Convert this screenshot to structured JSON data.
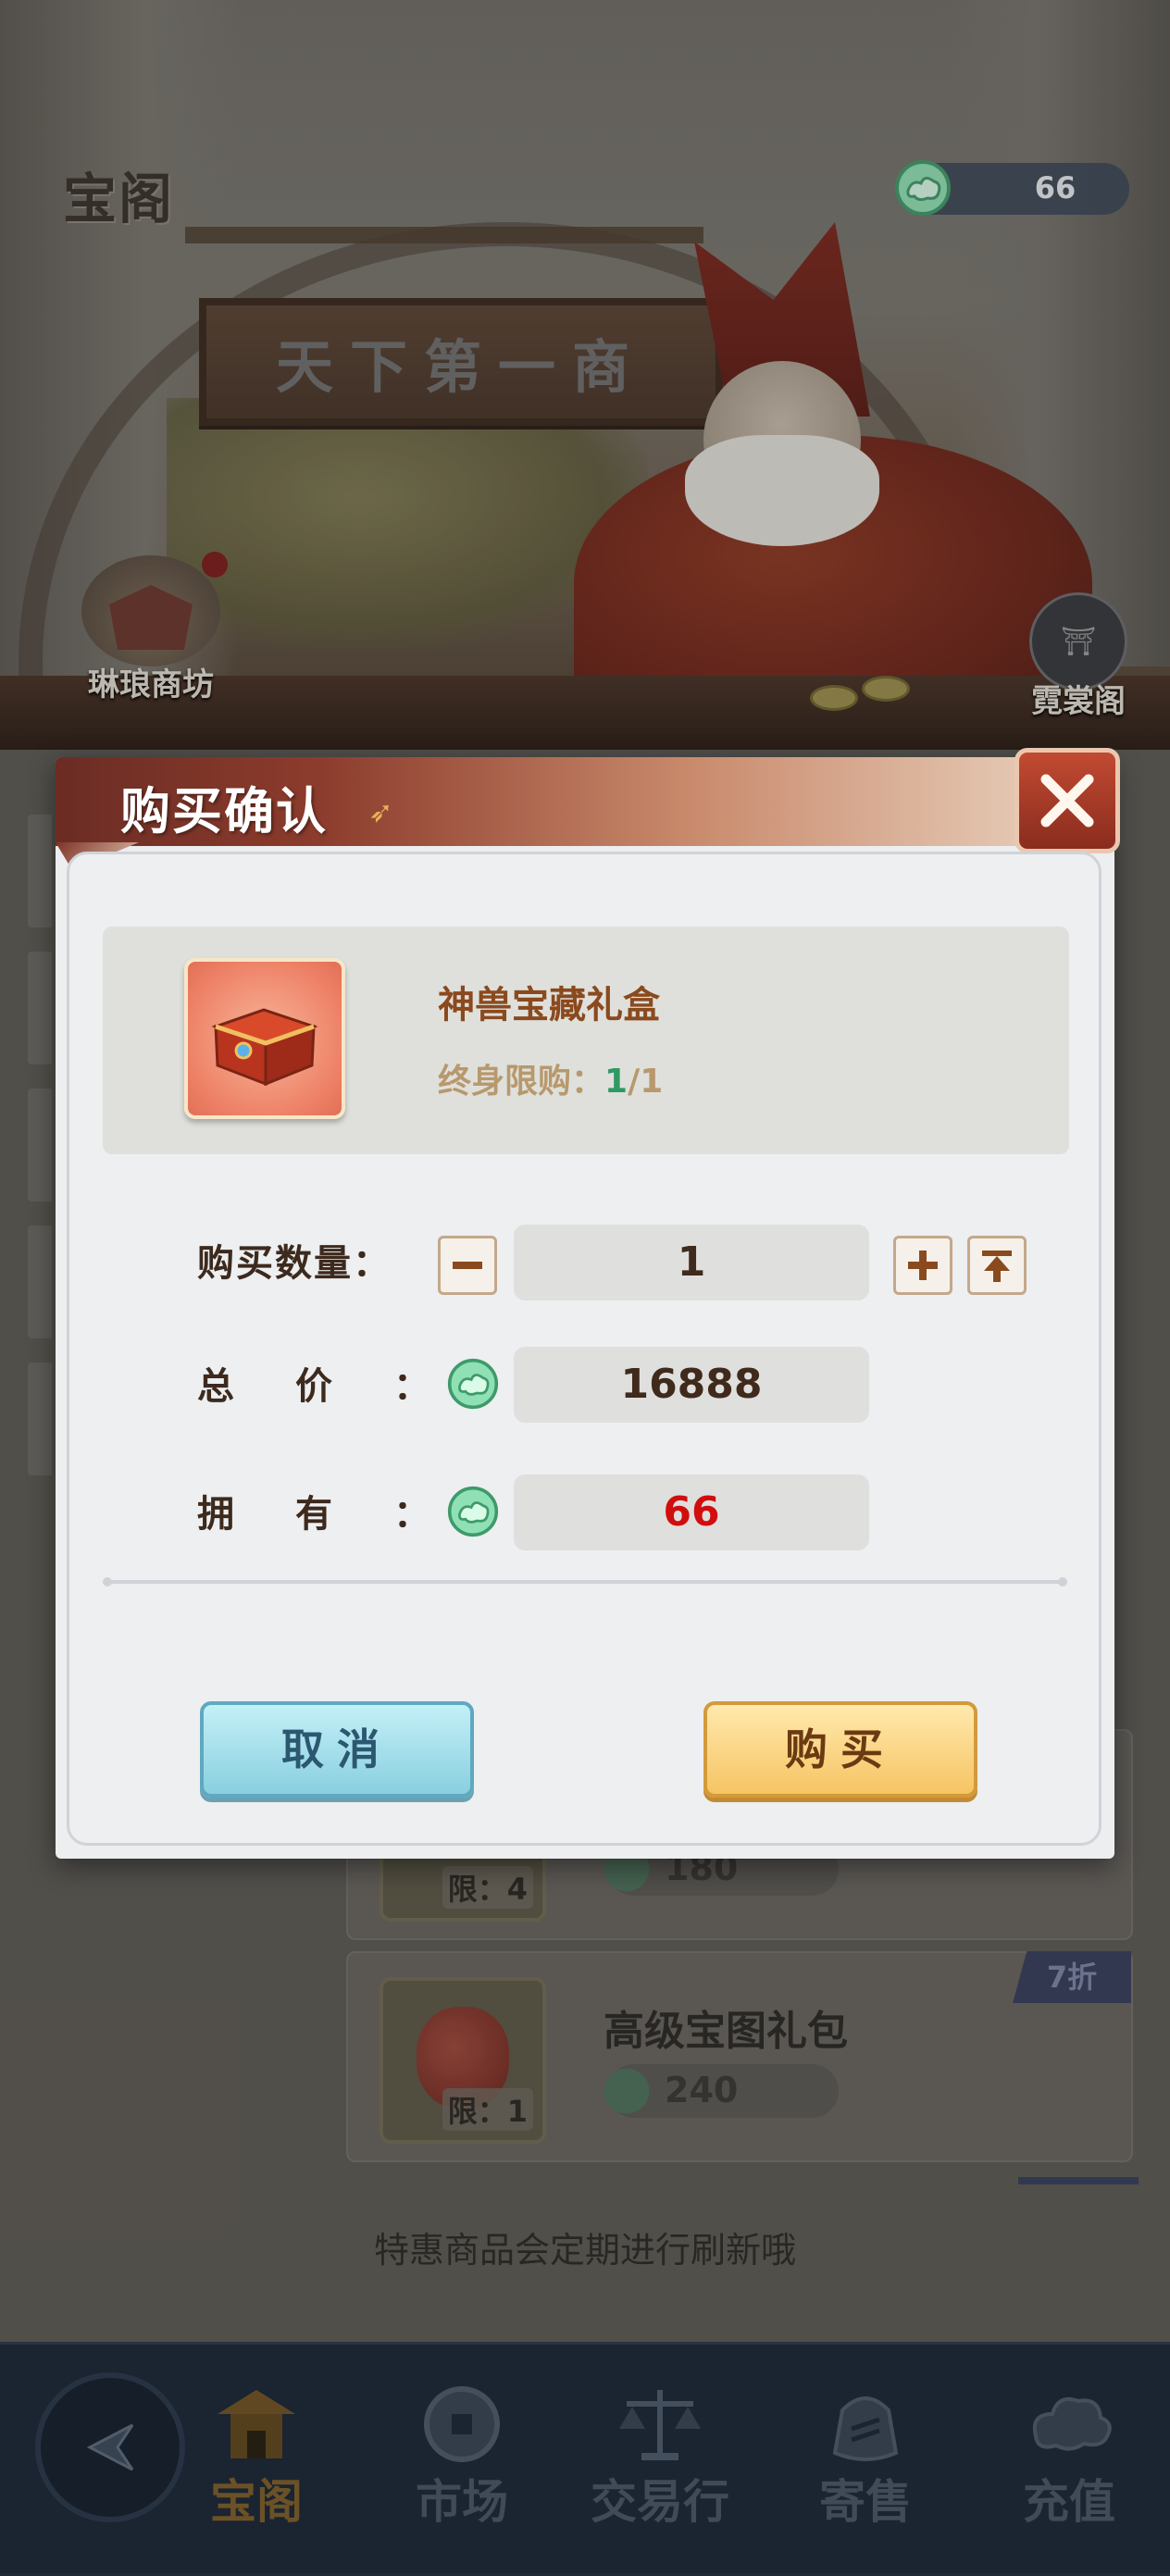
{
  "scene": {
    "title": "宝阁",
    "signboard": "天下第一商",
    "currency": {
      "icon": "jade-cloud-coin-icon",
      "amount": "66"
    },
    "left_nav_label": "琳琅商坊",
    "right_nav_label": "霓裳阁"
  },
  "list": {
    "cards": [
      {
        "limit": "限：4",
        "price": "180"
      },
      {
        "name": "高级宝图礼包",
        "limit": "限：1",
        "price": "240",
        "discount": "7折"
      }
    ],
    "hint": "特惠商品会定期进行刷新哦"
  },
  "dialog": {
    "title": "购买确认",
    "item": {
      "name": "神兽宝藏礼盒",
      "limit_label": "终身限购：",
      "limit_current": "1",
      "limit_total": "/1"
    },
    "quantity_label": "购买数量：",
    "quantity": "1",
    "total_label": "总价：",
    "total": "16888",
    "owned_label": "拥有：",
    "owned": "66",
    "cancel_label": "取消",
    "buy_label": "购买"
  },
  "bottom_nav": {
    "items": [
      {
        "label": "宝阁",
        "icon": "pavilion-icon",
        "active": true
      },
      {
        "label": "市场",
        "icon": "coin-icon"
      },
      {
        "label": "交易行",
        "icon": "scales-icon"
      },
      {
        "label": "寄售",
        "icon": "consign-bag-icon"
      },
      {
        "label": "充值",
        "icon": "cloud-icon"
      }
    ]
  },
  "colors": {
    "owned_insufficient": "#d10d0d",
    "limit_current": "#2e9a61",
    "item_name": "#8a4a1e",
    "cancel_button": "#89cfe0",
    "buy_button": "#f6c463"
  }
}
